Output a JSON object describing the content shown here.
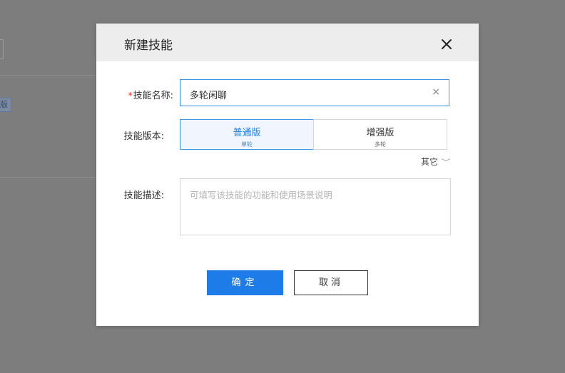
{
  "background": {
    "tag_text": "版"
  },
  "dialog": {
    "title": "新建技能",
    "close_icon": "close-icon",
    "fields": {
      "name": {
        "required_mark": "*",
        "label": "技能名称:",
        "value": "多轮闲聊",
        "clear_icon": "×"
      },
      "version": {
        "label": "技能版本:",
        "options": [
          {
            "title": "普通版",
            "subtitle": "单轮",
            "selected": true
          },
          {
            "title": "增强版",
            "subtitle": "多轮",
            "selected": false
          }
        ]
      },
      "other": {
        "label": "其它",
        "chevron": "﹀"
      },
      "description": {
        "label": "技能描述:",
        "placeholder": "可填写该技能的功能和使用场景说明"
      }
    },
    "buttons": {
      "ok": "确定",
      "cancel": "取消"
    }
  },
  "colors": {
    "accent": "#1d7ce8",
    "required": "#e0301e",
    "overlay": "#7f7f7f"
  }
}
